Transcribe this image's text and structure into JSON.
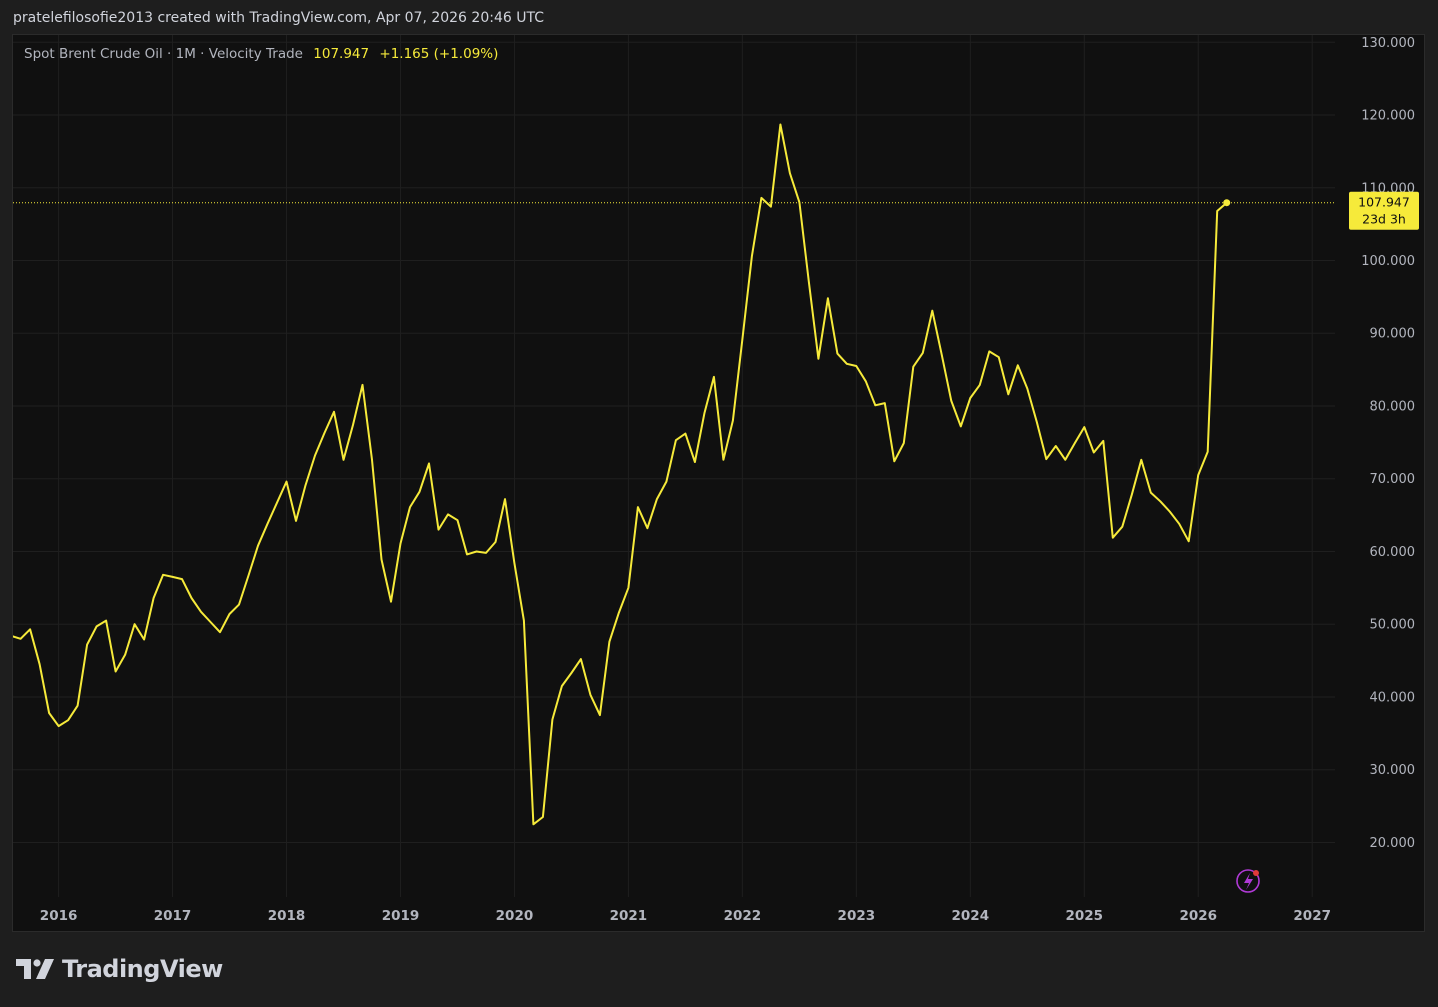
{
  "header": {
    "attribution": "pratelefilosofie2013 created with TradingView.com, Apr 07, 2026 20:46 UTC"
  },
  "legend": {
    "title": "Spot Brent Crude Oil · 1M · Velocity Trade",
    "last": "107.947",
    "change": "+1.165 (+1.09%)"
  },
  "price_label": {
    "value": "107.947",
    "countdown": "23d 3h"
  },
  "footer": {
    "brand": "TradingView"
  },
  "colors": {
    "line": "#f6ea3a",
    "background": "#101010",
    "grid": "#1f1f1f",
    "text": "#b2b5be",
    "flash_icon": "#b03ad6"
  },
  "icons": [
    "tradingview-logo-icon",
    "lightning-alert-icon"
  ],
  "chart_data": {
    "type": "line",
    "title": "Spot Brent Crude Oil · 1M · Velocity Trade",
    "xlabel": "",
    "ylabel": "",
    "grid": true,
    "ylim": [
      12.5,
      131
    ],
    "xlim": [
      2015.6,
      2027.2
    ],
    "y_ticks": [
      "20.000",
      "30.000",
      "40.000",
      "50.000",
      "60.000",
      "70.000",
      "80.000",
      "90.000",
      "100.000",
      "110.000",
      "120.000",
      "130.000"
    ],
    "x_ticks": [
      "2016",
      "2017",
      "2018",
      "2019",
      "2020",
      "2021",
      "2022",
      "2023",
      "2024",
      "2025",
      "2026",
      "2027"
    ],
    "series": [
      {
        "values": [
          [
            "2015-08",
            48.4
          ],
          [
            "2015-09",
            48.0
          ],
          [
            "2015-10",
            49.3
          ],
          [
            "2015-11",
            44.5
          ],
          [
            "2015-12",
            37.8
          ],
          [
            "2016-01",
            36.0
          ],
          [
            "2016-02",
            36.8
          ],
          [
            "2016-03",
            38.8
          ],
          [
            "2016-04",
            47.2
          ],
          [
            "2016-05",
            49.7
          ],
          [
            "2016-06",
            50.5
          ],
          [
            "2016-07",
            43.5
          ],
          [
            "2016-08",
            45.8
          ],
          [
            "2016-09",
            50.0
          ],
          [
            "2016-10",
            47.9
          ],
          [
            "2016-11",
            53.6
          ],
          [
            "2016-12",
            56.8
          ],
          [
            "2017-01",
            56.5
          ],
          [
            "2017-02",
            56.2
          ],
          [
            "2017-03",
            53.6
          ],
          [
            "2017-04",
            51.7
          ],
          [
            "2017-05",
            50.3
          ],
          [
            "2017-06",
            48.9
          ],
          [
            "2017-07",
            51.4
          ],
          [
            "2017-08",
            52.7
          ],
          [
            "2017-09",
            56.7
          ],
          [
            "2017-10",
            60.8
          ],
          [
            "2017-11",
            63.8
          ],
          [
            "2017-12",
            66.7
          ],
          [
            "2018-01",
            69.6
          ],
          [
            "2018-02",
            64.2
          ],
          [
            "2018-03",
            69.1
          ],
          [
            "2018-04",
            73.2
          ],
          [
            "2018-05",
            76.3
          ],
          [
            "2018-06",
            79.2
          ],
          [
            "2018-07",
            72.6
          ],
          [
            "2018-08",
            77.4
          ],
          [
            "2018-09",
            82.9
          ],
          [
            "2018-10",
            72.6
          ],
          [
            "2018-11",
            58.9
          ],
          [
            "2018-12",
            53.1
          ],
          [
            "2019-01",
            61.1
          ],
          [
            "2019-02",
            66.1
          ],
          [
            "2019-03",
            68.2
          ],
          [
            "2019-04",
            72.1
          ],
          [
            "2019-05",
            63.0
          ],
          [
            "2019-06",
            65.1
          ],
          [
            "2019-07",
            64.3
          ],
          [
            "2019-08",
            59.6
          ],
          [
            "2019-09",
            60.0
          ],
          [
            "2019-10",
            59.8
          ],
          [
            "2019-11",
            61.3
          ],
          [
            "2019-12",
            67.2
          ],
          [
            "2020-01",
            58.4
          ],
          [
            "2020-02",
            50.5
          ],
          [
            "2020-03",
            22.5
          ],
          [
            "2020-04",
            23.5
          ],
          [
            "2020-05",
            36.9
          ],
          [
            "2020-06",
            41.5
          ],
          [
            "2020-07",
            43.3
          ],
          [
            "2020-08",
            45.2
          ],
          [
            "2020-09",
            40.3
          ],
          [
            "2020-10",
            37.5
          ],
          [
            "2020-11",
            47.6
          ],
          [
            "2020-12",
            51.6
          ],
          [
            "2021-01",
            55.0
          ],
          [
            "2021-02",
            66.1
          ],
          [
            "2021-03",
            63.2
          ],
          [
            "2021-04",
            67.2
          ],
          [
            "2021-05",
            69.6
          ],
          [
            "2021-06",
            75.3
          ],
          [
            "2021-07",
            76.2
          ],
          [
            "2021-08",
            72.3
          ],
          [
            "2021-09",
            79.0
          ],
          [
            "2021-10",
            84.0
          ],
          [
            "2021-11",
            72.6
          ],
          [
            "2021-12",
            78.0
          ],
          [
            "2022-01",
            89.2
          ],
          [
            "2022-02",
            100.6
          ],
          [
            "2022-03",
            108.6
          ],
          [
            "2022-04",
            107.4
          ],
          [
            "2022-05",
            118.7
          ],
          [
            "2022-06",
            112.0
          ],
          [
            "2022-07",
            108.0
          ],
          [
            "2022-08",
            97.0
          ],
          [
            "2022-09",
            86.5
          ],
          [
            "2022-10",
            94.8
          ],
          [
            "2022-11",
            87.2
          ],
          [
            "2022-12",
            85.8
          ],
          [
            "2023-01",
            85.5
          ],
          [
            "2023-02",
            83.4
          ],
          [
            "2023-03",
            80.1
          ],
          [
            "2023-04",
            80.4
          ],
          [
            "2023-05",
            72.4
          ],
          [
            "2023-06",
            74.9
          ],
          [
            "2023-07",
            85.4
          ],
          [
            "2023-08",
            87.3
          ],
          [
            "2023-09",
            93.1
          ],
          [
            "2023-10",
            87.0
          ],
          [
            "2023-11",
            80.7
          ],
          [
            "2023-12",
            77.2
          ],
          [
            "2024-01",
            81.1
          ],
          [
            "2024-02",
            82.9
          ],
          [
            "2024-03",
            87.5
          ],
          [
            "2024-04",
            86.7
          ],
          [
            "2024-05",
            81.6
          ],
          [
            "2024-06",
            85.6
          ],
          [
            "2024-07",
            82.4
          ],
          [
            "2024-08",
            77.8
          ],
          [
            "2024-09",
            72.7
          ],
          [
            "2024-10",
            74.5
          ],
          [
            "2024-11",
            72.6
          ],
          [
            "2024-12",
            74.9
          ],
          [
            "2025-01",
            77.1
          ],
          [
            "2025-02",
            73.6
          ],
          [
            "2025-03",
            75.2
          ],
          [
            "2025-04",
            61.9
          ],
          [
            "2025-05",
            63.4
          ],
          [
            "2025-06",
            67.8
          ],
          [
            "2025-07",
            72.6
          ],
          [
            "2025-08",
            68.1
          ],
          [
            "2025-09",
            66.9
          ],
          [
            "2025-10",
            65.5
          ],
          [
            "2025-11",
            63.8
          ],
          [
            "2025-12",
            61.4
          ],
          [
            "2026-01",
            70.5
          ],
          [
            "2026-02",
            73.7
          ],
          [
            "2026-03",
            106.8
          ],
          [
            "2026-04",
            107.947
          ]
        ]
      }
    ],
    "last_value": 107.947
  }
}
